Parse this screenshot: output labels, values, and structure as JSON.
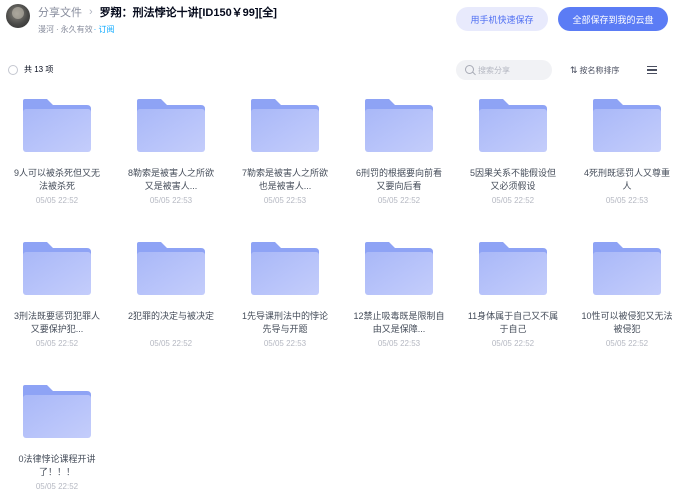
{
  "header": {
    "breadcrumb_parent": "分享文件",
    "breadcrumb_sep": "›",
    "title": "罗翔：刑法悖论十讲[ID150￥99][全]",
    "user": "漫河",
    "dot": "·",
    "validity": "永久有效",
    "subscribe": "· 订阅",
    "btn_phone": "用手机快速保存",
    "btn_save": "全部保存到我的云盘"
  },
  "toolbar": {
    "count": "共 13 项",
    "search_placeholder": "搜索分享",
    "sort_label": "按名称排序",
    "sort_icon": "⇅"
  },
  "files": [
    {
      "name": "9人可以被杀死但又无法被杀死",
      "date": "05/05 22:52"
    },
    {
      "name": "8勒索是被害人之所欲又是被害人...",
      "date": "05/05 22:53"
    },
    {
      "name": "7勒索是被害人之所欲也是被害人...",
      "date": "05/05 22:53"
    },
    {
      "name": "6刑罚的根据要向前看又要向后看",
      "date": "05/05 22:52"
    },
    {
      "name": "5因果关系不能假设但又必须假设",
      "date": "05/05 22:52"
    },
    {
      "name": "4死刑既惩罚人又尊重人",
      "date": "05/05 22:53"
    },
    {
      "name": "3刑法既要惩罚犯罪人又要保护犯...",
      "date": "05/05 22:52"
    },
    {
      "name": "2犯罪的决定与被决定",
      "date": "05/05 22:52"
    },
    {
      "name": "1先导课刑法中的悖论先导与开题",
      "date": "05/05 22:53"
    },
    {
      "name": "12禁止吸毒既是限制自由又是保障...",
      "date": "05/05 22:53"
    },
    {
      "name": "11身体属于自己又不属于自己",
      "date": "05/05 22:52"
    },
    {
      "name": "10性可以被侵犯又无法被侵犯",
      "date": "05/05 22:52"
    },
    {
      "name": "0法律悖论课程开讲了！！！",
      "date": "05/05 22:52"
    }
  ],
  "colors": {
    "accent": "#5b7cf5",
    "link": "#06a7ff",
    "folder_top": "#8ea3f5",
    "folder_body": "#a9b8f8"
  }
}
